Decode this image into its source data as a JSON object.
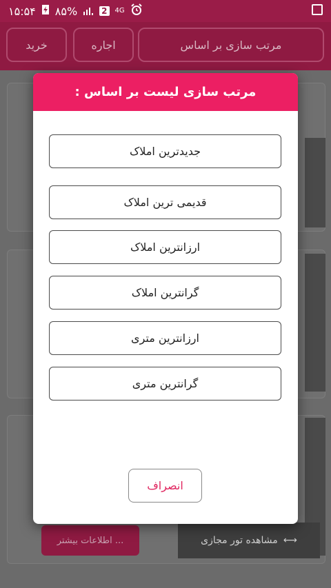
{
  "status_bar": {
    "time": "۱۵:۵۴",
    "battery": "۸۵%",
    "sim_slot": "2",
    "network": "4G",
    "icons": [
      "alarm-icon",
      "network-4g-icon",
      "sim-icon",
      "signal-icon",
      "battery-charging-icon",
      "gallery-icon"
    ]
  },
  "app_header": {
    "sort_label": "مرتب سازی بر اساس",
    "rent_label": "اجاره",
    "buy_label": "خرید"
  },
  "background": {
    "more_info_label": "اطلاعات بیشتر ...",
    "virtual_tour_label": "مشاهده تور مجازی"
  },
  "dialog": {
    "title": "مرتب سازی لیست بر اساس :",
    "options": [
      "جدیدترین املاک",
      "قدیمی ترین املاک",
      "ارزانترین املاک",
      "گرانترین املاک",
      "ارزانترین متری",
      "گرانترین متری"
    ],
    "cancel_label": "انصراف",
    "accent_color": "#ec1f63"
  }
}
